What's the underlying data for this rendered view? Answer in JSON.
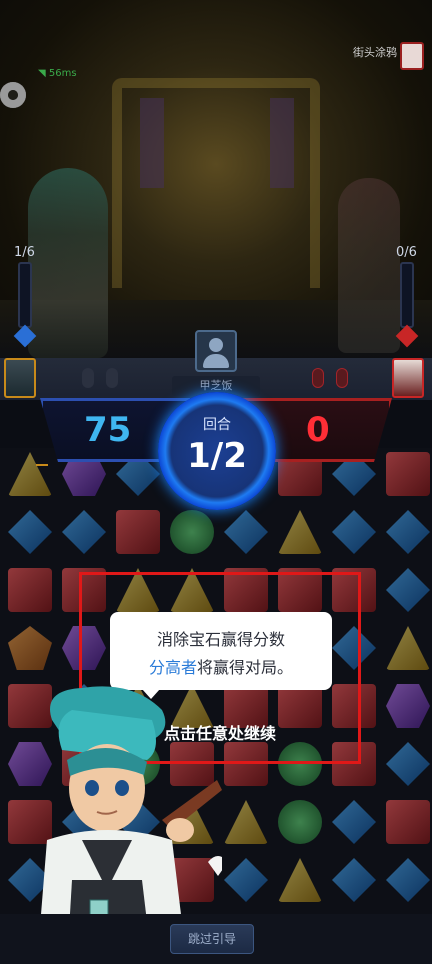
{
  "opponent": {
    "name": "街头涂鸦"
  },
  "network": {
    "ping": "56ms"
  },
  "left_counter": "1/6",
  "right_counter": "0/6",
  "player": {
    "name": "甲芝饭"
  },
  "score": {
    "player": "75",
    "opponent": "0"
  },
  "round": {
    "label": "回合",
    "value": "1/2"
  },
  "tutorial": {
    "line1": "消除宝石赢得分数",
    "line2_highlight": "分高者",
    "line2_rest": "将赢得对局。",
    "continue": "点击任意处继续"
  },
  "skip_button": "跳过引导",
  "colors": {
    "player_accent": "#3fb6f0",
    "opponent_accent": "#ff2e36",
    "highlight_frame": "#e01818",
    "bubble_highlight": "#2a7bd8"
  },
  "board": {
    "rows": [
      [
        "yellow",
        "purple",
        "blue",
        "blue",
        "blue",
        "red",
        "blue",
        "red"
      ],
      [
        "blue",
        "blue",
        "red",
        "green",
        "blue",
        "yellow",
        "blue",
        "blue"
      ],
      [
        "red",
        "red",
        "yellow",
        "yellow",
        "red",
        "red",
        "red",
        "blue"
      ],
      [
        "orange",
        "purple",
        "blue",
        "blue",
        "yellow",
        "red",
        "blue",
        "yellow"
      ],
      [
        "red",
        "blue",
        "yellow",
        "yellow",
        "red",
        "red",
        "red",
        "purple"
      ],
      [
        "purple",
        "red",
        "green",
        "red",
        "red",
        "green",
        "red",
        "blue"
      ],
      [
        "red",
        "blue",
        "blue",
        "yellow",
        "yellow",
        "green",
        "blue",
        "red"
      ],
      [
        "blue",
        "blue",
        "red",
        "red",
        "blue",
        "yellow",
        "blue",
        "blue"
      ]
    ]
  }
}
